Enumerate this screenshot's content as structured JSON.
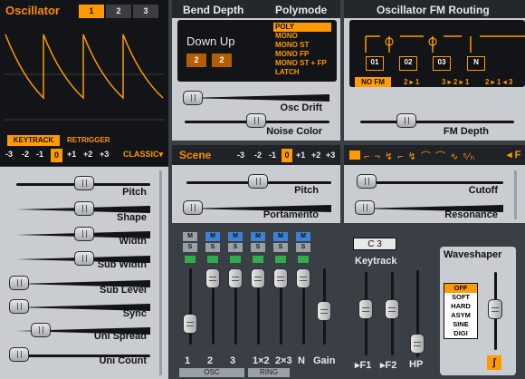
{
  "colors": {
    "accent": "#ff9a00",
    "panel": "#c9ccd1",
    "dark": "#121417",
    "header": "#24272c",
    "mute_blue": "#3b82d6"
  },
  "oscillator": {
    "title": "Oscillator",
    "tabs": [
      "1",
      "2",
      "3"
    ],
    "active_tab": "1",
    "keytrack": "KEYTRACK",
    "retrigger": "RETRIGGER",
    "octave": [
      "-3",
      "-2",
      "-1",
      "0",
      "+1",
      "+2",
      "+3"
    ],
    "octave_active": "0",
    "type": "CLASSIC",
    "params": [
      "Pitch",
      "Shape",
      "Width",
      "Sub Width",
      "Sub Level",
      "Sync",
      "Uni Spread",
      "Uni Count"
    ]
  },
  "bend": {
    "title": "Bend Depth",
    "value": "Down Up",
    "down": "2",
    "up": "2"
  },
  "polymode": {
    "title": "Polymode",
    "options": [
      "POLY",
      "MONO",
      "MONO ST",
      "MONO FP",
      "MONO ST + FP",
      "LATCH"
    ],
    "selected": "POLY"
  },
  "osc_drift": "Osc Drift",
  "noise_color": "Noise Color",
  "fm": {
    "title": "Oscillator FM Routing",
    "boxes": [
      "01",
      "02",
      "03",
      "N"
    ],
    "options": [
      "NO FM",
      "2 ▸ 1",
      "3 ▸ 2 ▸ 1",
      "2 ▸ 1 ◂ 3"
    ],
    "selected": "NO FM",
    "depth": "FM Depth"
  },
  "scene": {
    "title": "Scene",
    "octave": [
      "-3",
      "-2",
      "-1",
      "0",
      "+1",
      "+2",
      "+3"
    ],
    "octave_active": "0",
    "pitch": "Pitch",
    "portamento": "Portamento"
  },
  "filter": {
    "cutoff": "Cutoff",
    "resonance": "Resonance",
    "arrow": "◂ F"
  },
  "mixer": {
    "m": "M",
    "s": "S",
    "channels": [
      "1",
      "2",
      "3",
      "1×2",
      "2×3",
      "N"
    ],
    "gain": "Gain",
    "osc_group": "OSC",
    "ring_group": "RING"
  },
  "keytrack": {
    "note": "C 3",
    "title": "Keytrack",
    "f1": "▸F1",
    "f2": "▸F2",
    "hp": "HP"
  },
  "waveshaper": {
    "title": "Waveshaper",
    "options": [
      "OFF",
      "SOFT",
      "HARD",
      "ASYM",
      "SINE",
      "DIGI"
    ],
    "selected": "OFF",
    "icon": "ʃ"
  }
}
